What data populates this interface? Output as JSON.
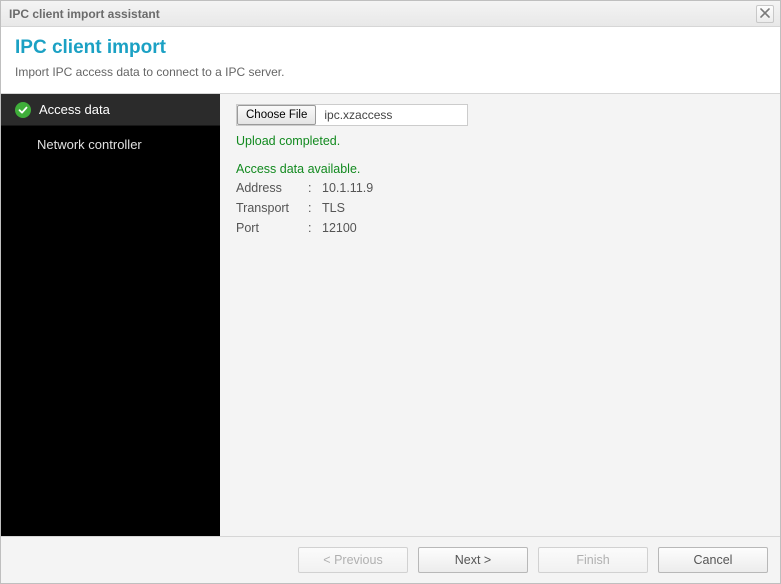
{
  "window": {
    "title": "IPC client import assistant"
  },
  "header": {
    "title": "IPC client import",
    "subtitle": "Import IPC access data to connect to a IPC server."
  },
  "sidebar": {
    "items": [
      {
        "label": "Access data"
      },
      {
        "label": "Network controller"
      }
    ]
  },
  "filechooser": {
    "button_label": "Choose File",
    "filename": "ipc.xzaccess"
  },
  "status": {
    "upload": "Upload completed.",
    "available": "Access data available."
  },
  "access": {
    "address_label": "Address",
    "address_value": "10.1.11.9",
    "transport_label": "Transport",
    "transport_value": "TLS",
    "port_label": "Port",
    "port_value": "12100"
  },
  "buttons": {
    "previous": "< Previous",
    "next": "Next >",
    "finish": "Finish",
    "cancel": "Cancel"
  }
}
